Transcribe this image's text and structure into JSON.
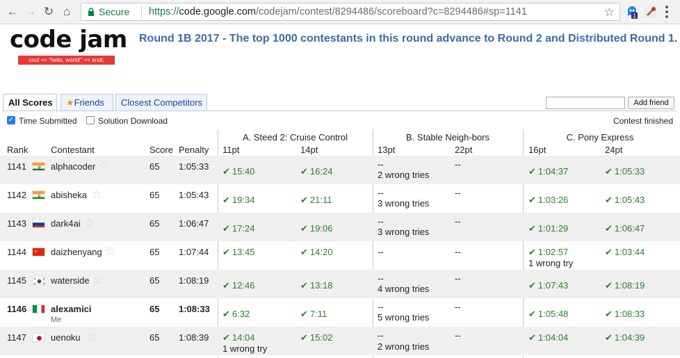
{
  "browser": {
    "secure_label": "Secure",
    "url_scheme": "https://",
    "url_host": "code.google.com",
    "url_path": "/codejam/contest/8294486/scoreboard?c=8294486#sp=1141",
    "ext_badge": "1"
  },
  "header": {
    "logo": "code jam",
    "tagline": "cout << \"hello, world!\" << endl;",
    "round_title": "Round 1B 2017 - The top 1000 contestants in this round advance to Round 2 and Distributed Round 1."
  },
  "tabs": [
    {
      "label": "All Scores"
    },
    {
      "label": "Friends"
    },
    {
      "label": "Closest Competitors"
    }
  ],
  "friend_box": {
    "button": "Add friend",
    "value": ""
  },
  "options": {
    "time_submitted": "Time Submitted",
    "time_submitted_checked": true,
    "solution_download": "Solution Download",
    "solution_download_checked": false,
    "status": "Contest finished"
  },
  "columns": {
    "rank": "Rank",
    "contestant": "Contestant",
    "score": "Score",
    "penalty": "Penalty"
  },
  "problems": [
    {
      "title": "A. Steed 2: Cruise Control",
      "small": "11pt",
      "large": "14pt"
    },
    {
      "title": "B. Stable Neigh-bors",
      "small": "13pt",
      "large": "22pt"
    },
    {
      "title": "C. Pony Express",
      "small": "16pt",
      "large": "24pt"
    }
  ],
  "me_label": "Me",
  "rows": [
    {
      "rank": "1141",
      "flag": "IN",
      "name": "alphacoder",
      "score": "65",
      "penalty": "1:05:33",
      "a_small": "15:40",
      "a_large": "16:24",
      "a_note": "",
      "b_small": "--",
      "b_large": "--",
      "b_note": "2 wrong tries",
      "c_small": "1:04:37",
      "c_large": "1:05:33",
      "c_note": ""
    },
    {
      "rank": "1142",
      "flag": "IN",
      "name": "abisheka",
      "score": "65",
      "penalty": "1:05:43",
      "a_small": "19:34",
      "a_large": "21:11",
      "a_note": "",
      "b_small": "--",
      "b_large": "--",
      "b_note": "3 wrong tries",
      "c_small": "1:03:26",
      "c_large": "1:05:43",
      "c_note": ""
    },
    {
      "rank": "1143",
      "flag": "RU",
      "name": "dark4ai",
      "score": "65",
      "penalty": "1:06:47",
      "a_small": "17:24",
      "a_large": "19:06",
      "a_note": "",
      "b_small": "--",
      "b_large": "--",
      "b_note": "3 wrong tries",
      "c_small": "1:01:29",
      "c_large": "1:06:47",
      "c_note": ""
    },
    {
      "rank": "1144",
      "flag": "CN",
      "name": "daizhenyang",
      "score": "65",
      "penalty": "1:07:44",
      "a_small": "13:45",
      "a_large": "14:20",
      "a_note": "",
      "b_small": "--",
      "b_large": "--",
      "b_note": "",
      "c_small": "1:02:57",
      "c_large": "1:03:44",
      "c_note": "1 wrong try"
    },
    {
      "rank": "1145",
      "flag": "KR",
      "name": "waterside",
      "score": "65",
      "penalty": "1:08:19",
      "a_small": "12:46",
      "a_large": "13:18",
      "a_note": "",
      "b_small": "--",
      "b_large": "--",
      "b_note": "4 wrong tries",
      "c_small": "1:07:43",
      "c_large": "1:08:19",
      "c_note": ""
    },
    {
      "rank": "1146",
      "flag": "IT",
      "name": "alexamici",
      "score": "65",
      "penalty": "1:08:33",
      "a_small": "6:32",
      "a_large": "7:11",
      "a_note": "",
      "b_small": "--",
      "b_large": "--",
      "b_note": "5 wrong tries",
      "c_small": "1:05:48",
      "c_large": "1:08:33",
      "c_note": ""
    },
    {
      "rank": "1147",
      "flag": "JP",
      "name": "uenoku",
      "score": "65",
      "penalty": "1:08:39",
      "a_small": "14:04",
      "a_large": "15:02",
      "a_note": "1 wrong try",
      "b_small": "--",
      "b_large": "--",
      "b_note": "2 wrong tries",
      "c_small": "1:04:04",
      "c_large": "1:04:39",
      "c_note": ""
    }
  ]
}
